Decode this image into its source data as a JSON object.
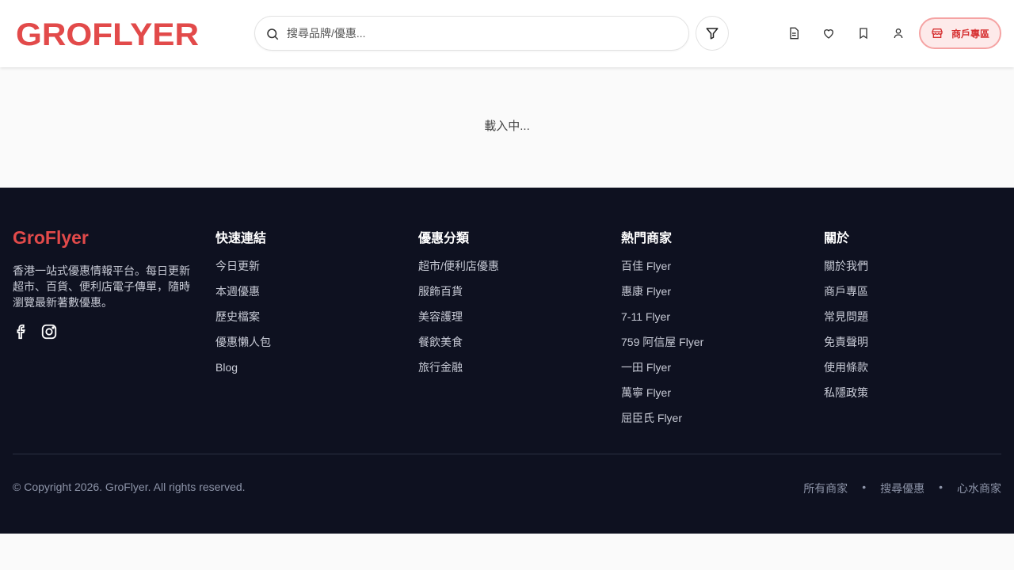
{
  "header": {
    "logo_text": "GROFLYER",
    "search_placeholder": "搜尋品牌/優惠...",
    "merchant_label": "商戶專區",
    "icons": [
      "document-icon",
      "heart-icon",
      "bookmark-icon",
      "user-icon"
    ]
  },
  "main": {
    "loading_text": "載入中..."
  },
  "footer": {
    "brand": "GroFlyer",
    "description": "香港一站式優惠情報平台。每日更新超市、百貨、便利店電子傳單，隨時瀏覽最新著數優惠。",
    "columns": [
      {
        "title": "快速連結",
        "items": [
          "今日更新",
          "本週優惠",
          "歷史檔案",
          "優惠懶人包",
          "Blog"
        ]
      },
      {
        "title": "優惠分類",
        "items": [
          "超市/便利店優惠",
          "服飾百貨",
          "美容護理",
          "餐飲美食",
          "旅行金融"
        ]
      },
      {
        "title": "熱門商家",
        "items": [
          "百佳 Flyer",
          "惠康 Flyer",
          "7-11 Flyer",
          "759 阿信屋 Flyer",
          "一田 Flyer",
          "萬寧 Flyer",
          "屈臣氏 Flyer"
        ]
      },
      {
        "title": "關於",
        "items": [
          "關於我們",
          "商戶專區",
          "常見問題",
          "免責聲明",
          "使用條款",
          "私隱政策"
        ]
      }
    ],
    "copyright": "© Copyright 2026. GroFlyer. All rights reserved.",
    "bottom_links": [
      "所有商家",
      "搜尋優惠",
      "心水商家"
    ],
    "separator": "•"
  },
  "colors": {
    "brand_red": "#e24a4a",
    "footer_bg": "#0e1120"
  }
}
